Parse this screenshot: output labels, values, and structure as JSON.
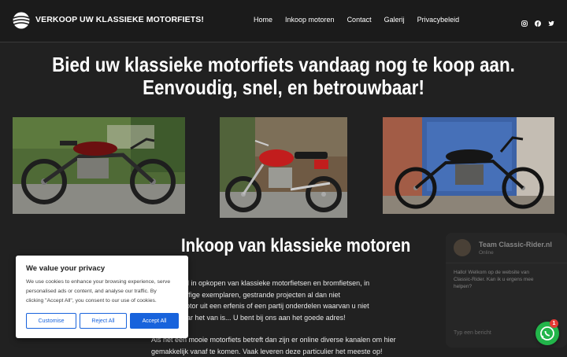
{
  "header": {
    "brand": "VERKOOP UW KLASSIEKE MOTORFIETS!",
    "nav": [
      "Home",
      "Inkoop motoren",
      "Contact",
      "Galerij",
      "Privacybeleid"
    ],
    "social_icons": [
      "instagram-icon",
      "facebook-icon",
      "twitter-icon"
    ]
  },
  "hero": {
    "title_line1": "Bied uw klassieke motorfiets vandaag nog te koop aan.",
    "title_line2": "Eenvoudig, snel, en betrouwbaar!"
  },
  "section": {
    "title": "Inkoop van klassieke motoren",
    "para1": [
      "pecialiseerd in opkopen van klassieke motorfietsen en bromfietsen, in",
      "er oude stoffige exemplaren, gestrande projecten al dan niet",
      "erd. Een motor uit een erfenis of een partij onderdelen waarvan u niet",
      "es weet waar het van is... U bent bij ons aan het goede adres!"
    ],
    "para2": [
      "Als het een mooie motorfiets betreft dan zijn er online diverse kanalen om hier",
      "gemakkelijk vanaf te komen. Vaak leveren deze particulier het meeste op!"
    ]
  },
  "chat": {
    "name": "Team Classic-Rider.nl",
    "sub": "Online",
    "message": [
      "Hallo! Welkom op de website van",
      "Classic-Rider. Kan ik u ergens mee",
      "helpen?"
    ],
    "time": "",
    "input_placeholder": "Typ een bericht"
  },
  "whatsapp": {
    "badge": "1"
  },
  "cookie": {
    "title": "We value your privacy",
    "text": [
      "We use cookies to enhance your browsing experience, serve",
      "personalised ads or content, and analyse our traffic. By",
      "clicking \"Accept All\", you consent to our use of cookies."
    ],
    "customise": "Customise",
    "reject": "Reject All",
    "accept": "Accept All"
  }
}
